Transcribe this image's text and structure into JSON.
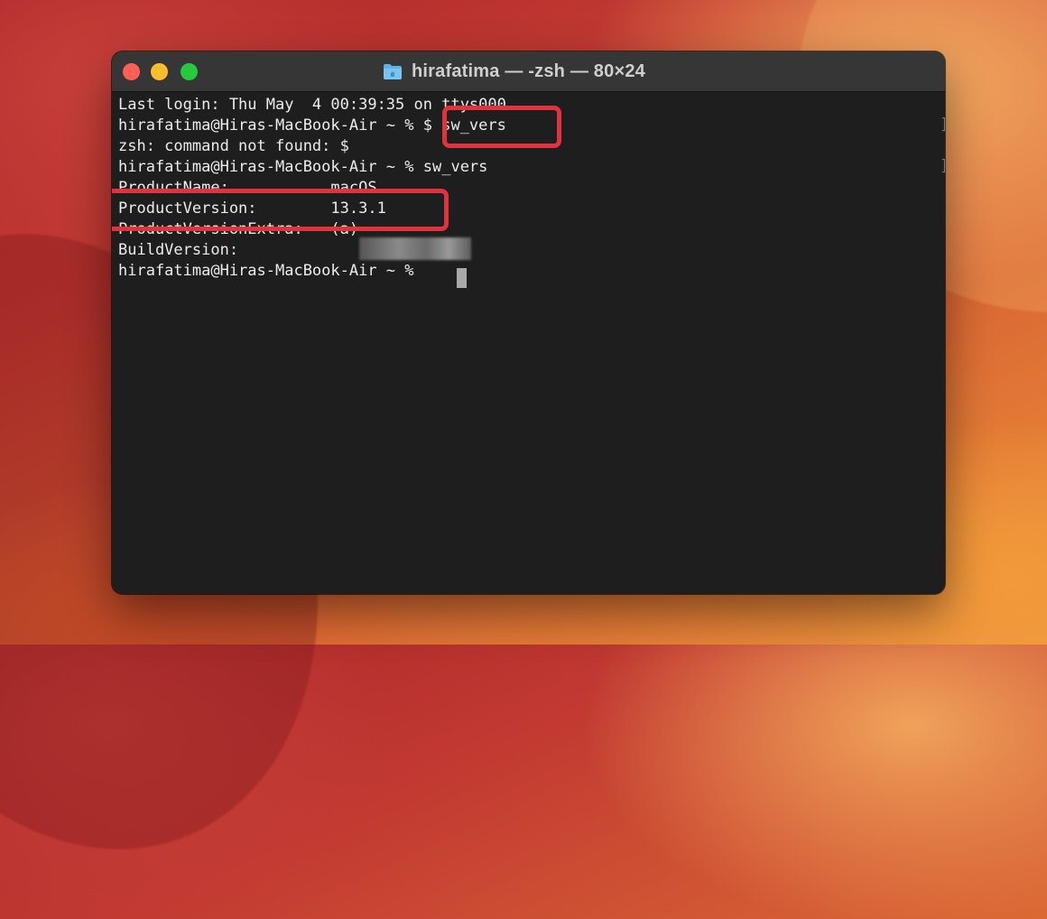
{
  "window": {
    "title": "hirafatima — -zsh — 80×24"
  },
  "terminal": {
    "lines": [
      "Last login: Thu May  4 00:39:35 on ttys000",
      "hirafatima@Hiras-MacBook-Air ~ % $ sw_vers",
      "zsh: command not found: $",
      "hirafatima@Hiras-MacBook-Air ~ % sw_vers",
      "ProductName:           macOS",
      "ProductVersion:        13.3.1",
      "ProductVersionExtra:   (a)",
      "BuildVersion:          ",
      "hirafatima@Hiras-MacBook-Air ~ % "
    ]
  },
  "icons": {
    "folder": "folder-icon"
  },
  "colors": {
    "highlight": "#e0323f",
    "terminal_bg": "#1e1e1e",
    "titlebar_bg": "#363636",
    "close": "#ff5f57",
    "minimize": "#febc2e",
    "maximize": "#28c840"
  }
}
